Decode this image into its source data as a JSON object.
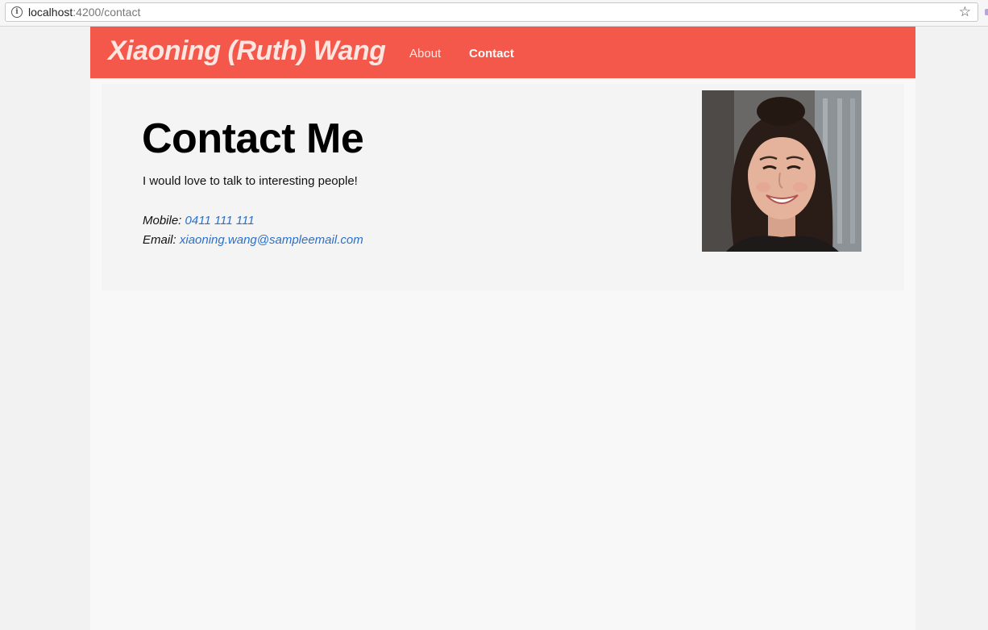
{
  "browser": {
    "url_host": "localhost",
    "url_path": ":4200/contact"
  },
  "navbar": {
    "brand": "Xiaoning (Ruth) Wang",
    "links": [
      {
        "label": "About"
      },
      {
        "label": "Contact"
      }
    ]
  },
  "contact": {
    "heading": "Contact Me",
    "lead": "I would love to talk to interesting people!",
    "mobile_label": "Mobile:",
    "mobile_value": "0411 111 111",
    "email_label": "Email:",
    "email_value": "xiaoning.wang@sampleemail.com"
  },
  "icons": {
    "info": "info-icon",
    "bookmark": "star-icon"
  },
  "colors": {
    "brand": "#f4584a",
    "link": "#2b70c9"
  }
}
